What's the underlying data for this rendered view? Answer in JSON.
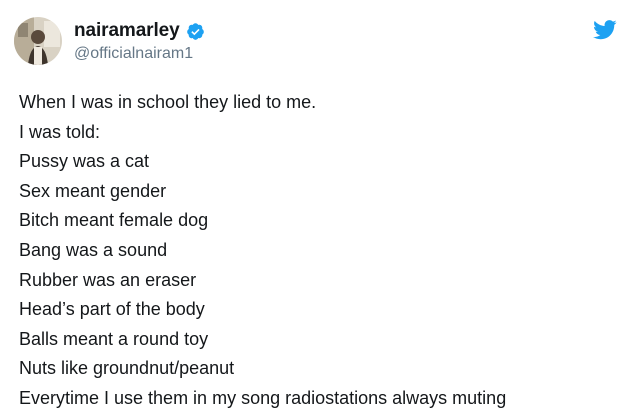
{
  "user": {
    "display_name": "nairamarley",
    "handle": "@officialnairam1",
    "verified": true,
    "avatar_icon": "avatar-photo",
    "verified_icon": "verified-badge-icon"
  },
  "brand": {
    "icon": "twitter-bird-icon",
    "color": "#1da1f2"
  },
  "tweet": {
    "lines": [
      "When I was in school they lied to me.",
      "I was told:",
      "Pussy was a cat",
      "Sex meant gender",
      "Bitch meant female dog",
      "Bang was a sound",
      "Rubber was an eraser",
      "Head’s part of the body",
      "Balls meant a round toy",
      "Nuts like groundnut/peanut",
      "Everytime I use them in my song radiostations always muting"
    ]
  }
}
